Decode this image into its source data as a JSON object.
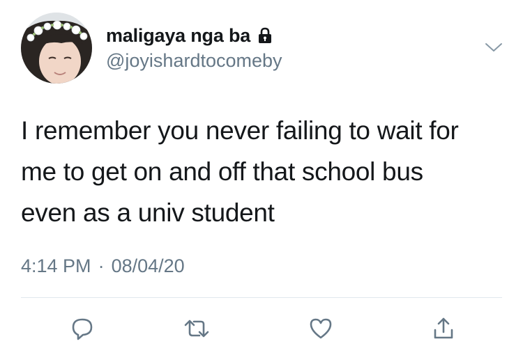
{
  "user": {
    "display_name": "maligaya nga ba",
    "handle": "@joyishardtocomeby",
    "protected_icon": "lock-icon",
    "avatar_icon": "profile-photo"
  },
  "tweet": {
    "text_lines": [
      "I remember you never failing to wait for",
      "me to get on and off that school bus",
      "even as a univ student"
    ],
    "time": "4:14 PM",
    "separator": "·",
    "date": "08/04/20"
  },
  "actions": [
    {
      "icon": "reply-icon"
    },
    {
      "icon": "retweet-icon"
    },
    {
      "icon": "like-icon"
    },
    {
      "icon": "share-icon"
    }
  ],
  "colors": {
    "text": "#14171a",
    "secondary": "#657786",
    "divider": "#e1e8ed"
  }
}
